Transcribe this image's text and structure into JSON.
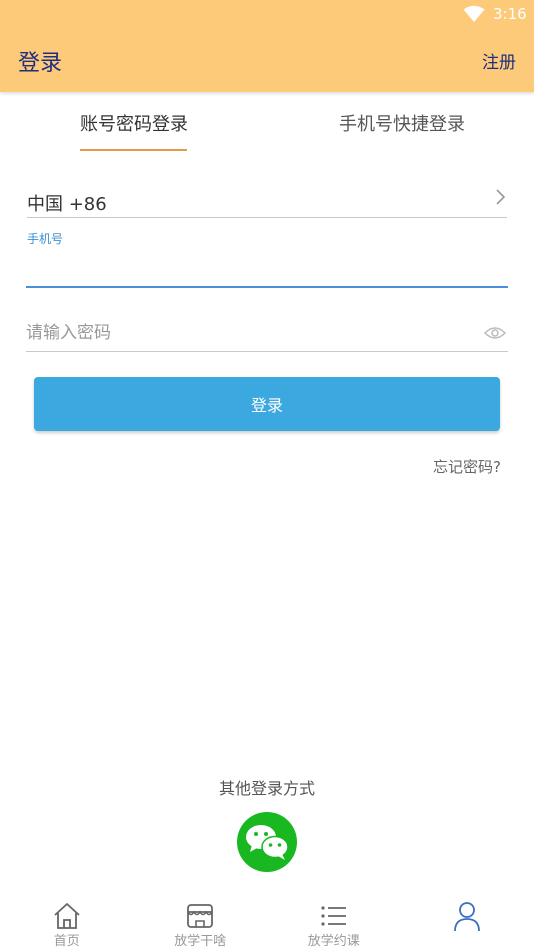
{
  "status_bar": {
    "time": "3:16"
  },
  "header": {
    "title": "登录",
    "register_label": "注册"
  },
  "tabs": [
    {
      "label": "账号密码登录",
      "active": true
    },
    {
      "label": "手机号快捷登录",
      "active": false
    }
  ],
  "form": {
    "country": "中国 +86",
    "phone_label": "手机号",
    "phone_value": "",
    "password_placeholder": "请输入密码",
    "login_button": "登录",
    "forgot_password": "忘记密码?"
  },
  "other_login": {
    "label": "其他登录方式",
    "icon": "wechat-icon"
  },
  "bottom_nav": [
    {
      "label": "首页",
      "icon": "home-icon",
      "active": false
    },
    {
      "label": "放学干啥",
      "icon": "shop-icon",
      "active": false
    },
    {
      "label": "放学约课",
      "icon": "list-icon",
      "active": false
    },
    {
      "label": "",
      "icon": "user-icon",
      "active": true
    }
  ],
  "colors": {
    "header_bg": "#fdca7a",
    "header_text": "#1e2f80",
    "accent_underline": "#e59a45",
    "button_blue": "#3ba9df",
    "wechat_green": "#19b720"
  }
}
